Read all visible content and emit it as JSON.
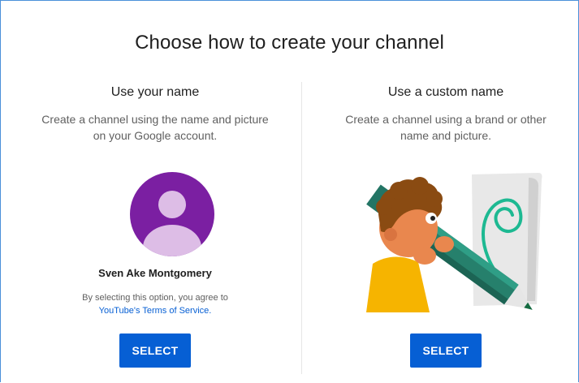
{
  "dialog": {
    "title": "Choose how to create your channel"
  },
  "left_option": {
    "heading": "Use your name",
    "description_line1": "Create a channel using the name and picture",
    "description_line2": "on your Google account.",
    "avatar_icon": "default-user-avatar-icon",
    "avatar_color": "#7b1fa2",
    "account_name": "Sven Ake Montgomery",
    "terms_prefix": "By selecting this option, you agree to",
    "terms_link": "YouTube's Terms of Service.",
    "select_label": "SELECT"
  },
  "right_option": {
    "heading": "Use a custom name",
    "description_line1": "Create a channel using a brand or other",
    "description_line2": "name and picture.",
    "illustration_icon": "child-with-giant-pencil-illustration",
    "select_label": "SELECT"
  },
  "colors": {
    "button": "#065fd4",
    "link": "#065fd4"
  }
}
